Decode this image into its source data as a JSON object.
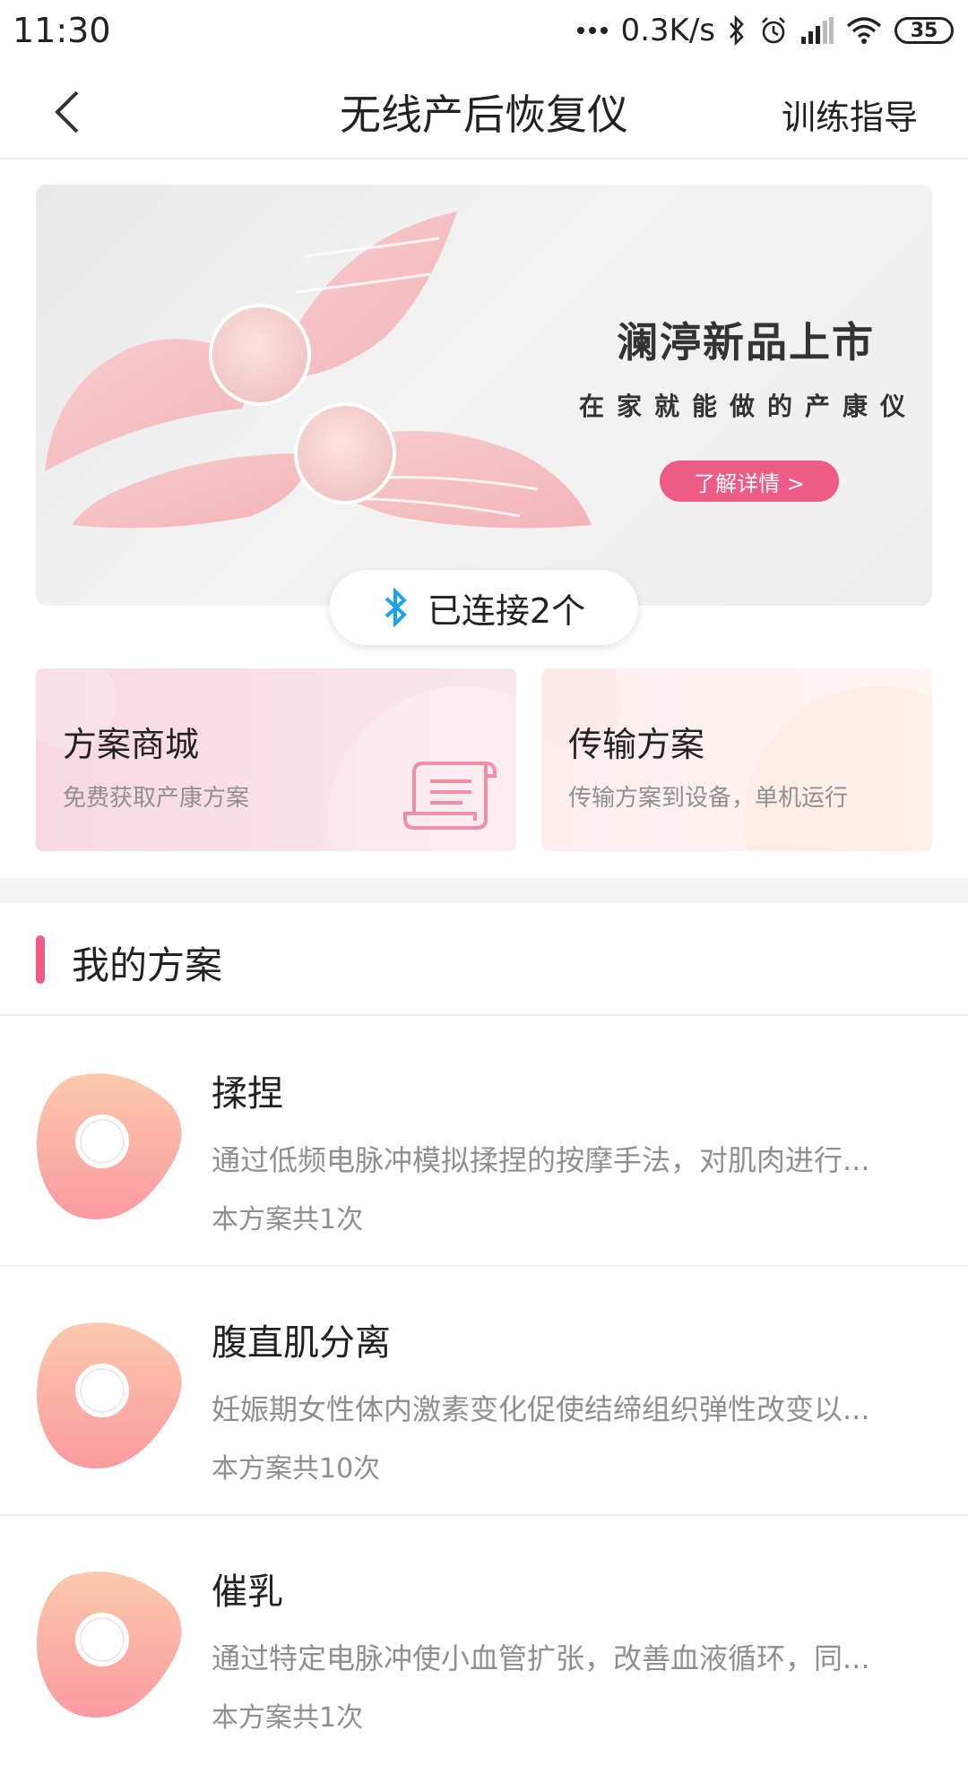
{
  "status_bar": {
    "time": "11:30",
    "network_speed": "0.3K/s",
    "battery": "35",
    "icons": [
      "dots-icon",
      "bluetooth-icon",
      "alarm-icon",
      "signal-icon",
      "wifi-icon",
      "battery-icon"
    ]
  },
  "header": {
    "title": "无线产后恢复仪",
    "action_label": "训练指导"
  },
  "banner": {
    "title": "澜渟新品上市",
    "subtitle": "在家就能做的产康仪",
    "cta_label": "了解详情 >"
  },
  "connection": {
    "label": "已连接2个",
    "icon": "bluetooth-icon",
    "icon_color": "#1aa3e8"
  },
  "cards": [
    {
      "title": "方案商城",
      "desc": "免费获取产康方案",
      "icon": "scroll-icon"
    },
    {
      "title": "传输方案",
      "desc": "传输方案到设备，单机运行"
    }
  ],
  "section": {
    "title": "我的方案"
  },
  "plans": [
    {
      "name": "揉捏",
      "desc": "通过低频电脉冲模拟揉捏的按摩手法，对肌肉进行...",
      "count": "本方案共1次"
    },
    {
      "name": "腹直肌分离",
      "desc": "妊娠期女性体内激素变化促使结缔组织弹性改变以...",
      "count": "本方案共10次"
    },
    {
      "name": "催乳",
      "desc": "通过特定电脉冲使小血管扩张，改善血液循环，同...",
      "count": "本方案共1次"
    }
  ],
  "colors": {
    "accent": "#ee5b86",
    "bluetooth": "#1aa3e8",
    "secondary_text": "#8f8f8f"
  }
}
